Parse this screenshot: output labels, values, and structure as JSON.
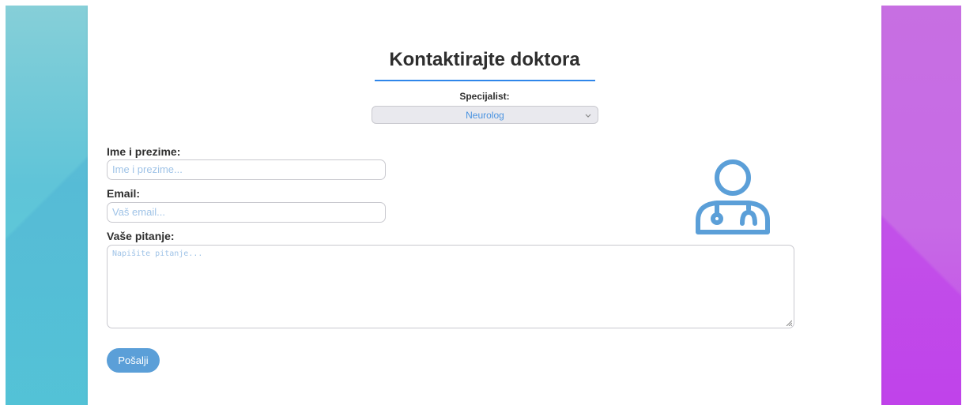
{
  "form": {
    "title": "Kontaktirajte doktora",
    "specialist_label": "Specijalist:",
    "specialist_selected": "Neurolog",
    "name_label": "Ime i prezime:",
    "name_placeholder": "Ime i prezime...",
    "email_label": "Email:",
    "email_placeholder": "Vaš email...",
    "question_label": "Vaše pitanje:",
    "question_placeholder": "Napišite pitanje...",
    "submit_label": "Pošalji"
  },
  "icons": {
    "doctor": "doctor-icon",
    "select_chevron": "chevron-down-icon"
  },
  "colors": {
    "accent": "#2f86ea",
    "button": "#5b9fd8",
    "icon": "#5b9fd8",
    "placeholder": "#9fc3e7",
    "left_bg": "#5fc4d8",
    "right_bg": "#c76ae6"
  }
}
